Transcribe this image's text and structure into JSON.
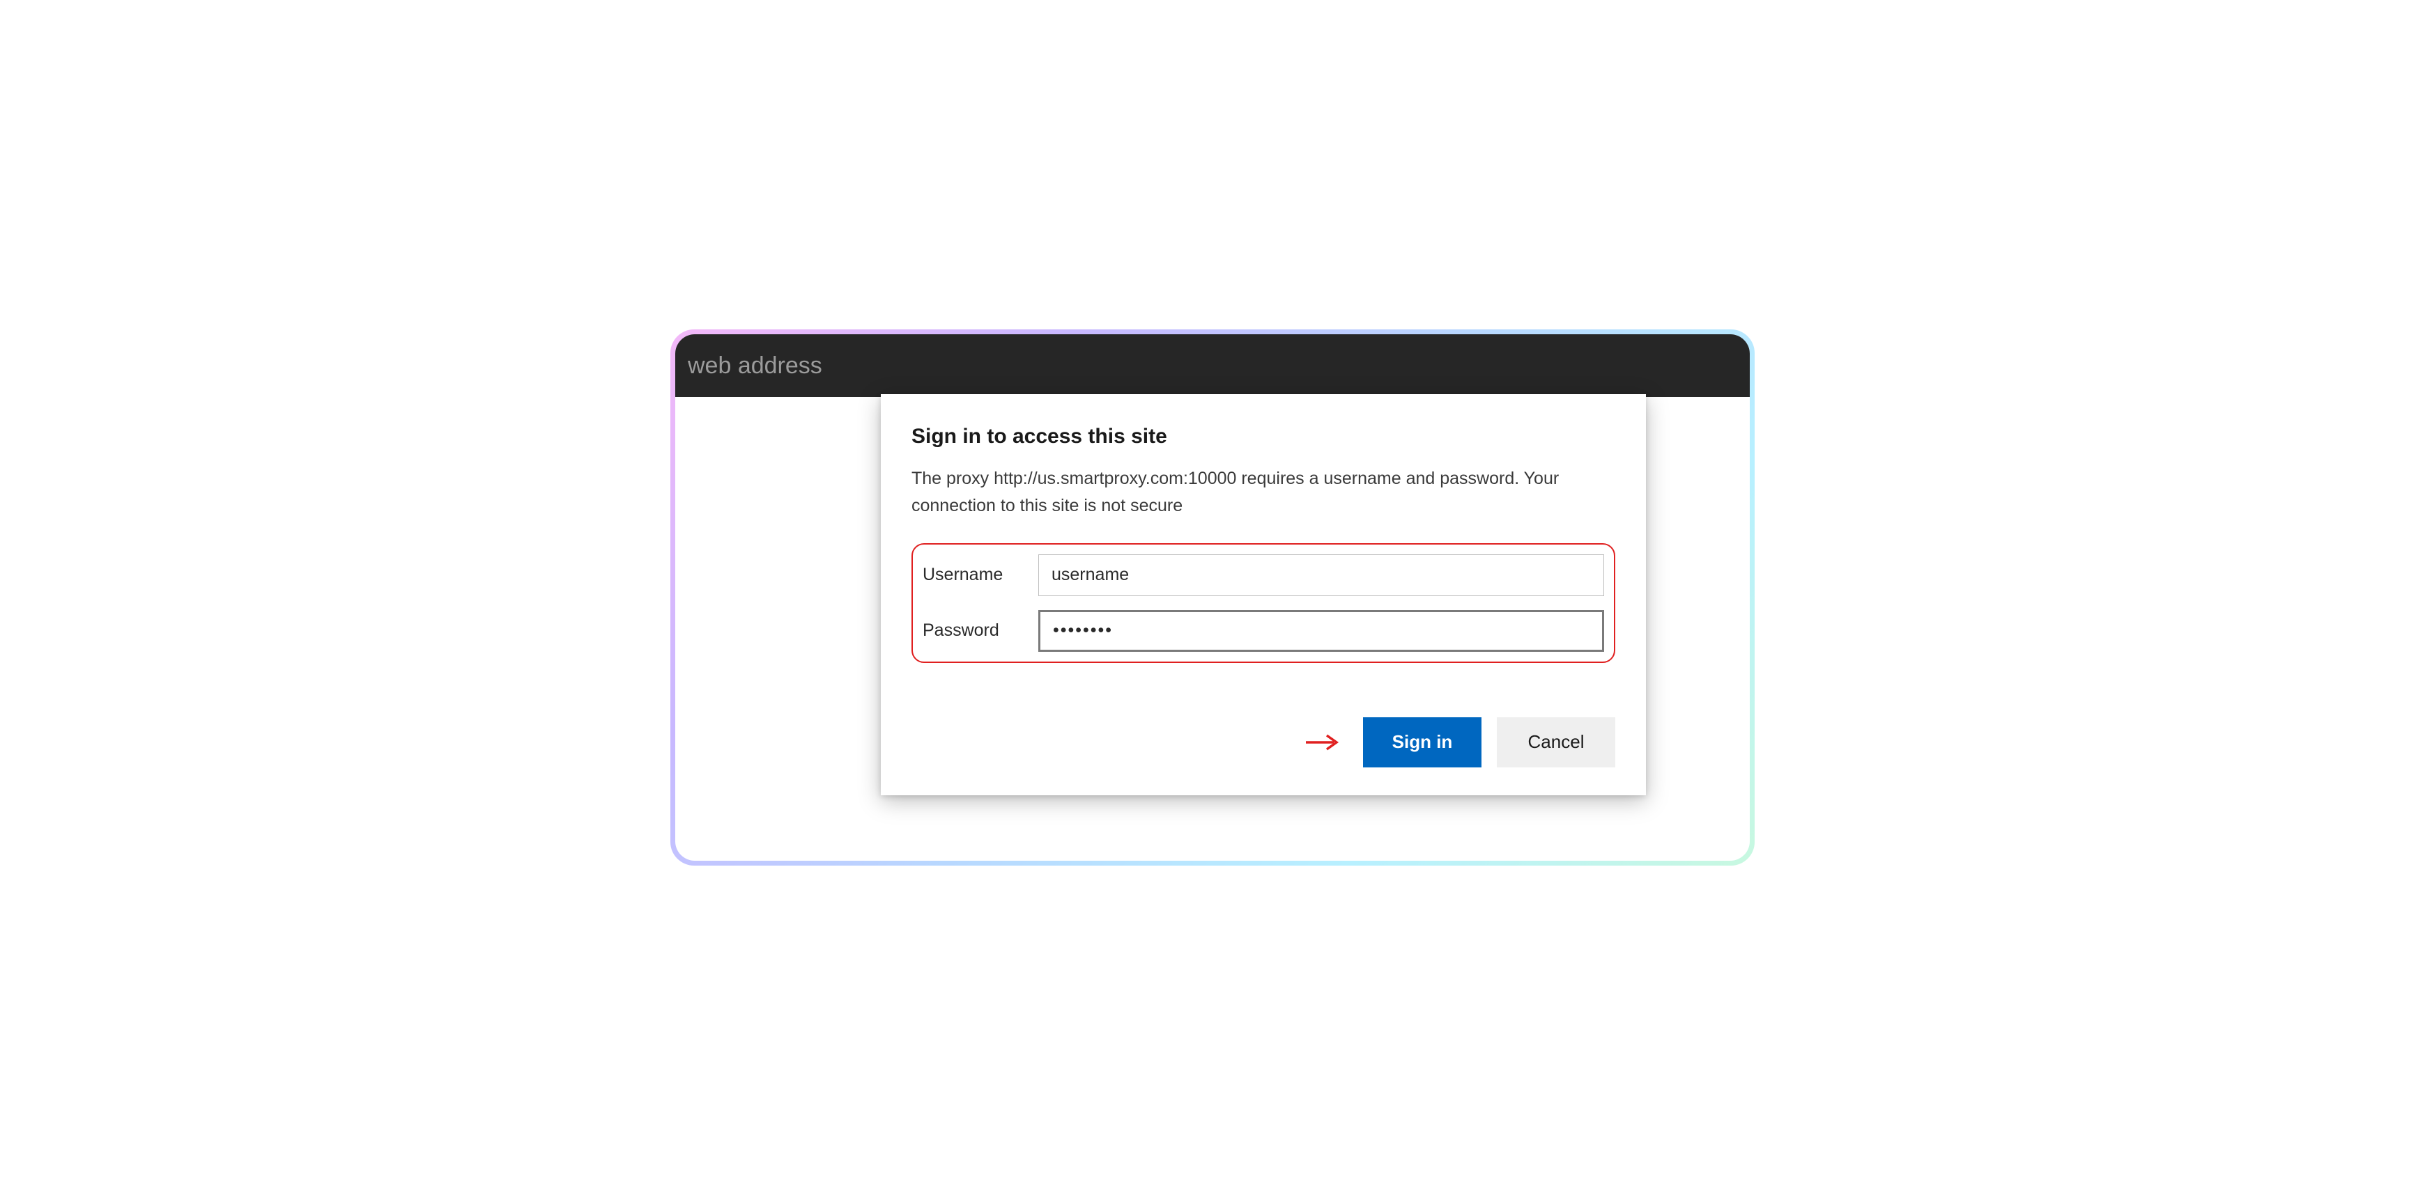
{
  "addressbar": {
    "placeholder": "web address"
  },
  "dialog": {
    "title": "Sign in to access this site",
    "message": "The proxy http://us.smartproxy.com:10000 requires a username and password. Your connection to this site is not secure",
    "username_label": "Username",
    "password_label": "Password",
    "username_value": "username",
    "password_value": "••••••••",
    "signin_label": "Sign in",
    "cancel_label": "Cancel"
  },
  "annotation": {
    "highlight_color": "#e02020"
  }
}
